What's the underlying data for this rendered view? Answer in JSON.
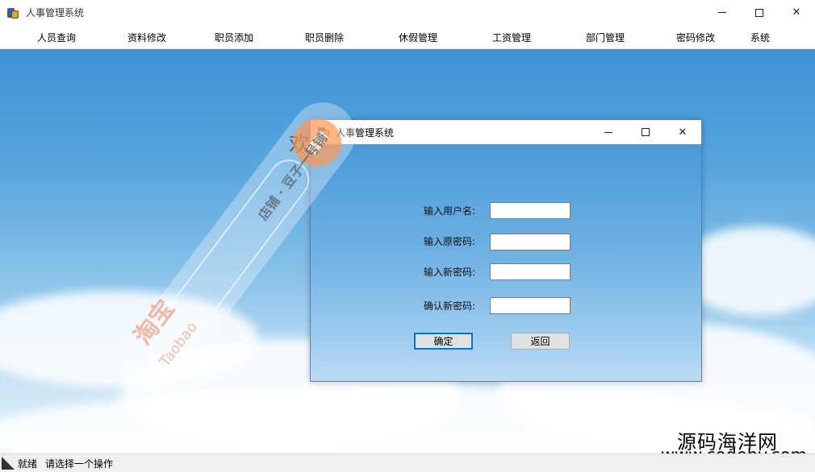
{
  "window": {
    "title": "人事管理系统",
    "minimize_icon": "minimize-icon",
    "maximize_icon": "maximize-icon",
    "close_label": "✕"
  },
  "menu": {
    "items": [
      "人员查询",
      "资料修改",
      "职员添加",
      "职员删除",
      "休假管理",
      "工资管理",
      "部门管理",
      "密码修改",
      "系统"
    ]
  },
  "main": {
    "welcome_text": "欢"
  },
  "status": {
    "ready": "就绪",
    "message": "请选择一个操作"
  },
  "dialog": {
    "title": "人事管理系统",
    "close_label": "✕",
    "fields": {
      "username_label": "输入用户名:",
      "username_value": "",
      "old_password_label": "输入原密码:",
      "old_password_value": "",
      "new_password_label": "输入新密码:",
      "new_password_value": "",
      "confirm_password_label": "确认新密码:",
      "confirm_password_value": ""
    },
    "ok_label": "确定",
    "back_label": "返回"
  },
  "watermarks": {
    "site_name": "源码海洋网",
    "site_url": "www.codehy.com",
    "taobao_search": "搜索",
    "taobao_shop": "店铺 · 豆子一号铺",
    "taobao_brand": "淘宝",
    "taobao_brand_en": "Taobao"
  },
  "colors": {
    "dialog_border": "#5a7fb5",
    "default_button_border": "#0078d7",
    "sky_top": "#3f92d6",
    "sky_bottom": "#e9f4fb"
  }
}
